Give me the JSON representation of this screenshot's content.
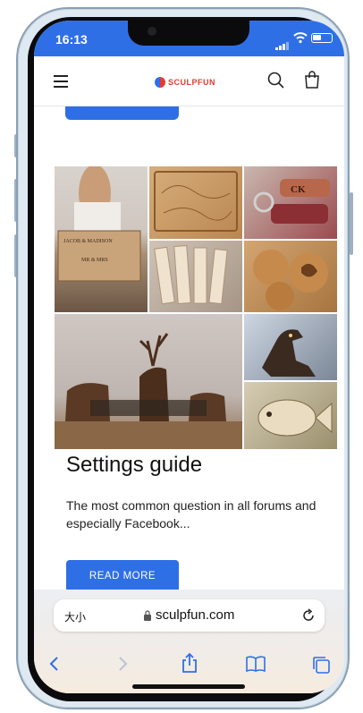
{
  "status_bar": {
    "time": "16:13"
  },
  "header": {
    "brand": "SCULPFUN"
  },
  "post": {
    "title": "Settings guide",
    "excerpt": "The most common question in all forums and especially Facebook...",
    "read_more_label": "READ MORE"
  },
  "collage": {
    "tiles": [
      "wedding-box-photo",
      "engraved-wood-map",
      "leather-keychains",
      "wood-bookmarks",
      "wood-coasters",
      "deer-family-carving",
      "dinosaur-carving",
      "fish-carving"
    ],
    "text_marks": {
      "names": "JACOB & MADISON",
      "mrmrs": "MR & MRS",
      "initials": "CK"
    }
  },
  "safari": {
    "text_size_label": "大小",
    "url": "sculpfun.com"
  },
  "colors": {
    "accent": "#2f6fe6",
    "brand_red": "#e63b2e"
  },
  "icons": [
    "menu-icon",
    "search-icon",
    "cart-icon",
    "lock-icon",
    "reload-icon",
    "back-icon",
    "forward-icon",
    "share-icon",
    "bookmarks-icon",
    "tabs-icon"
  ]
}
